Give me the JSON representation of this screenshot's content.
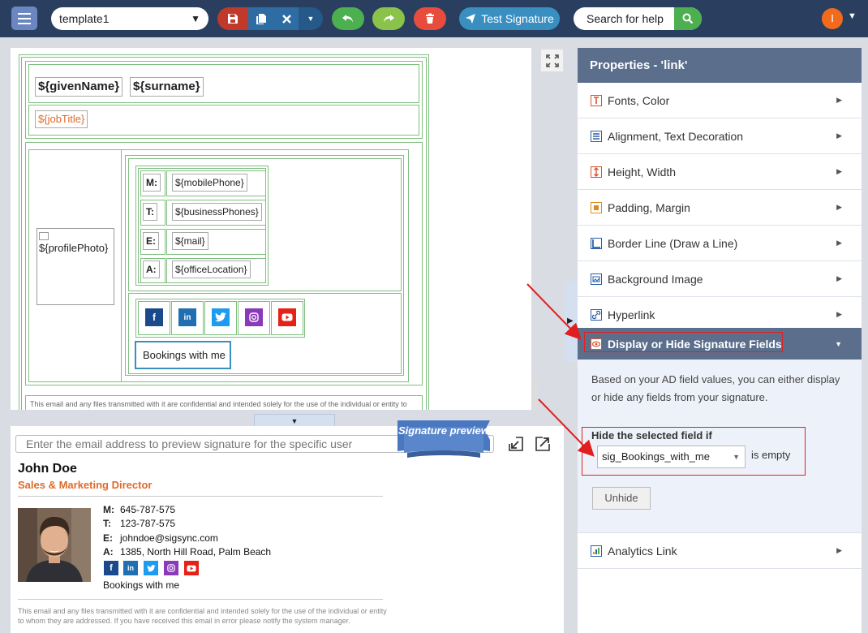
{
  "topbar": {
    "template_name": "template1",
    "test_signature_label": "Test Signature",
    "help_search_placeholder": "Search for help",
    "user_initial": "I",
    "colors": {
      "bar": "#2a3f5f",
      "save": "#c0392b",
      "action_group": "#2e6da4",
      "undo": "#4caf50",
      "redo": "#8bc34a",
      "delete": "#e74c3c",
      "test": "#3a8fc1"
    }
  },
  "editor": {
    "given_name": "${givenName}",
    "surname": "${surname}",
    "job_title": "${jobTitle}",
    "profile_photo": "${profilePhoto}",
    "contacts": [
      {
        "label": "M:",
        "value": "${mobilePhone}"
      },
      {
        "label": "T:",
        "value": "${businessPhones}"
      },
      {
        "label": "E:",
        "value": "${mail}"
      },
      {
        "label": "A:",
        "value": "${officeLocation}"
      }
    ],
    "social": [
      "facebook-icon",
      "linkedin-icon",
      "twitter-icon",
      "instagram-icon",
      "youtube-icon"
    ],
    "bookings": "Bookings with me",
    "disclaimer": "This email and any files transmitted with it are confidential and intended solely for the use of the individual or entity to"
  },
  "preview": {
    "input_placeholder": "Enter the email address to preview signature for the specific user",
    "ribbon": "Signature preview",
    "name": "John Doe",
    "title": "Sales & Marketing Director",
    "contacts": [
      {
        "label": "M:",
        "value": "645-787-575"
      },
      {
        "label": "T:",
        "value": "123-787-575"
      },
      {
        "label": "E:",
        "value": "johndoe@sigsync.com"
      },
      {
        "label": "A:",
        "value": "1385, North Hill Road, Palm Beach"
      }
    ],
    "bookings": "Bookings with me",
    "disclaimer": "This email and any files transmitted with it are confidential and intended solely for the use of the individual or entity to whom they are addressed. If you have received this email in error please notify the system manager."
  },
  "properties": {
    "header": "Properties - 'link'",
    "items": [
      {
        "label": "Fonts, Color",
        "icon": "font-icon"
      },
      {
        "label": "Alignment, Text Decoration",
        "icon": "align-icon"
      },
      {
        "label": "Height, Width",
        "icon": "height-icon"
      },
      {
        "label": "Padding, Margin",
        "icon": "padding-icon"
      },
      {
        "label": "Border Line (Draw a Line)",
        "icon": "border-icon"
      },
      {
        "label": "Background Image",
        "icon": "image-icon"
      },
      {
        "label": "Hyperlink",
        "icon": "link-icon"
      },
      {
        "label": "Display or Hide Signature Fields",
        "icon": "eye-icon"
      },
      {
        "label": "Analytics Link",
        "icon": "analytics-icon"
      }
    ],
    "expanded": {
      "description": "Based on your AD field values, you can either display or hide any fields from your signature.",
      "hide_label": "Hide the selected field if",
      "selected_field": "sig_Bookings_with_me",
      "condition": "is empty",
      "unhide_label": "Unhide"
    }
  }
}
